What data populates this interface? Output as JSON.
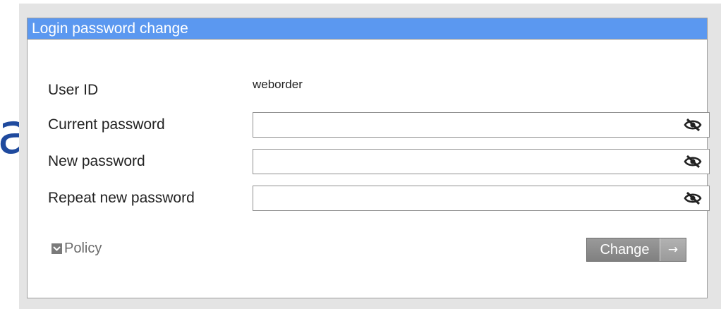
{
  "background_fragment": "a",
  "panel": {
    "title": "Login password change",
    "title_color": "#5b98f0"
  },
  "form": {
    "user_id_label": "User ID",
    "user_id_value": "weborder",
    "current_password_label": "Current password",
    "current_password_value": "",
    "new_password_label": "New password",
    "new_password_value": "",
    "repeat_password_label": "Repeat new password",
    "repeat_password_value": "",
    "visibility_icon": "eye-slash-icon"
  },
  "policy": {
    "label": "Policy",
    "icon": "chevron-down-icon"
  },
  "change_button": {
    "label": "Change",
    "arrow": "→"
  }
}
